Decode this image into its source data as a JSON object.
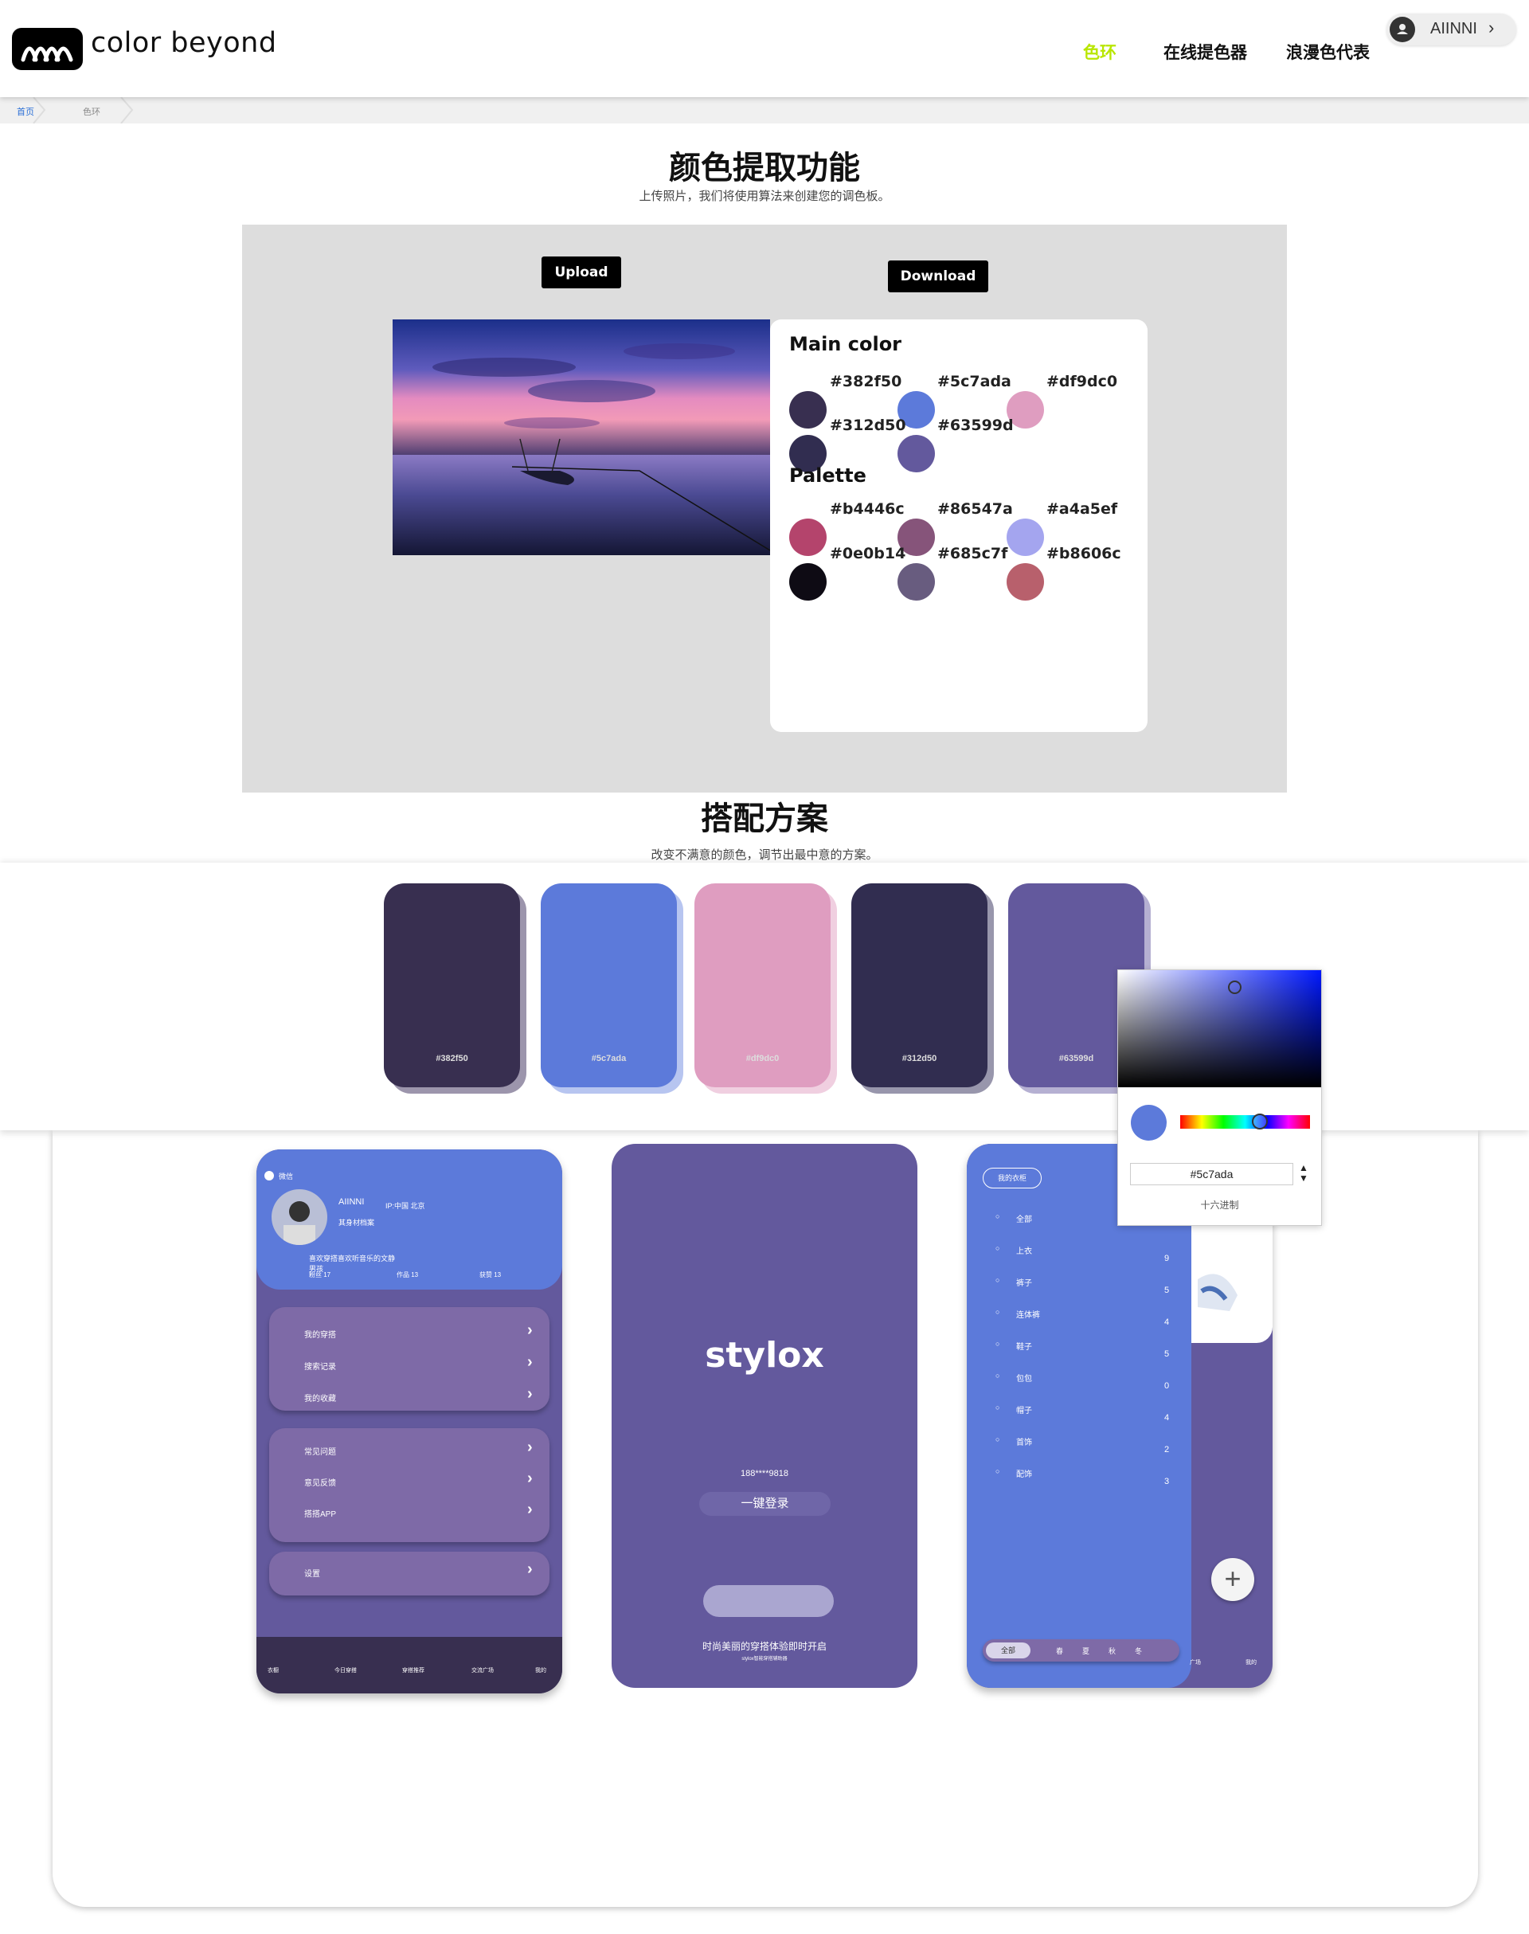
{
  "header": {
    "logo_text": "color beyond",
    "nav": [
      "色环",
      "在线提色器",
      "浪漫色代表"
    ],
    "active_color": "#b8e600",
    "user": "AIINNI"
  },
  "breadcrumb": [
    "首页",
    "色环"
  ],
  "extract": {
    "title": "颜色提取功能",
    "subtitle": "上传照片，我们将使用算法来创建您的调色板。",
    "upload": "Upload",
    "download": "Download",
    "main_heading": "Main color",
    "palette_heading": "Palette",
    "main_colors": [
      "#382f50",
      "#5c7ada",
      "#df9dc0",
      "#312d50",
      "#63599d"
    ],
    "palette_colors": [
      "#b4446c",
      "#86547a",
      "#a4a5ef",
      "#0e0b14",
      "#685c7f",
      "#b8606c"
    ]
  },
  "scheme": {
    "title": "搭配方案",
    "subtitle": "改变不满意的颜色，调节出最中意的方案。",
    "swatches": [
      "#382f50",
      "#5c7ada",
      "#df9dc0",
      "#312d50",
      "#63599d"
    ]
  },
  "picker": {
    "hex": "#5c7ada",
    "caption": "十六进制"
  },
  "phone1": {
    "header": "微信",
    "name": "AIINNI",
    "ip": "IP:中国 北京",
    "profile": "其身材档案",
    "bio": "喜欢穿搭喜欢听音乐的文静男孩",
    "stats": [
      "粉丝 17",
      "作品 13",
      "获赞 13"
    ],
    "menu_a": [
      "我的穿搭",
      "搜索记录",
      "我的收藏"
    ],
    "menu_b": [
      "常见问题",
      "意见反馈",
      "搭搭APP"
    ],
    "menu_c": [
      "设置"
    ],
    "tabs": [
      "衣橱",
      "今日穿搭",
      "穿搭推荐",
      "交流广场",
      "我的"
    ]
  },
  "phone2": {
    "brand": "stylox",
    "phone": "188****9818",
    "login": "一键登录",
    "tagline": "时尚美丽的穿搭体验即时开启",
    "small": "stylox智能穿搭辅助器"
  },
  "phone3": {
    "tag": "我的衣柜",
    "categories": [
      {
        "name": "全部",
        "count": ""
      },
      {
        "name": "上衣",
        "count": "9"
      },
      {
        "name": "裤子",
        "count": "5"
      },
      {
        "name": "连体裤",
        "count": "4"
      },
      {
        "name": "鞋子",
        "count": "5"
      },
      {
        "name": "包包",
        "count": "0"
      },
      {
        "name": "帽子",
        "count": "4"
      },
      {
        "name": "首饰",
        "count": "2"
      },
      {
        "name": "配饰",
        "count": "3"
      }
    ],
    "seasons": [
      "全部",
      "春",
      "夏",
      "秋",
      "冬"
    ],
    "tabs": [
      "广场",
      "我的"
    ]
  }
}
